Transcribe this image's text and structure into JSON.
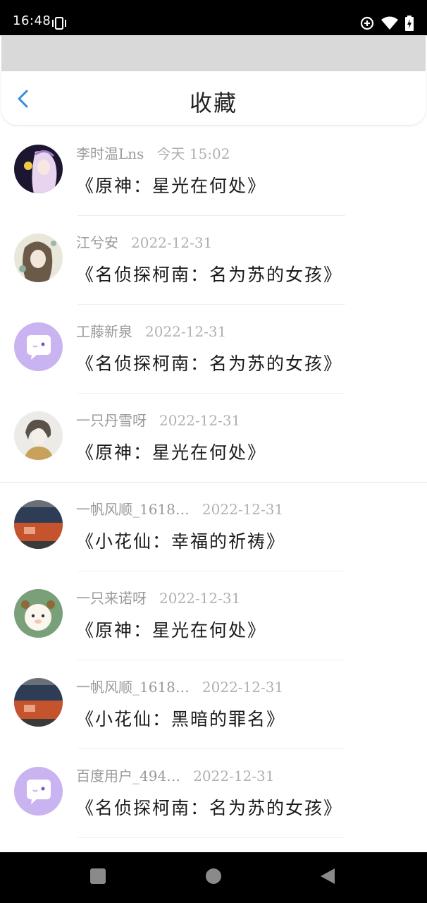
{
  "status": {
    "time": "16:48"
  },
  "header": {
    "title": "收藏"
  },
  "items": [
    {
      "user": "李时温Lns",
      "date": "今天 15:02",
      "title": "《原神：星光在何处》",
      "avatar": "anime-girl-avatar"
    },
    {
      "user": "江兮安",
      "date": "2022-12-31",
      "title": "《名侦探柯南：名为苏的女孩》",
      "avatar": "illustration-avatar"
    },
    {
      "user": "工藤新泉",
      "date": "2022-12-31",
      "title": "《名侦探柯南：名为苏的女孩》",
      "avatar": "default-chat-avatar"
    },
    {
      "user": "一只丹雪呀",
      "date": "2022-12-31",
      "title": "《原神：星光在何处》",
      "avatar": "sketch-boy-avatar"
    },
    {
      "user": "一帆风顺_1618…",
      "date": "2022-12-31",
      "title": "《小花仙：幸福的祈祷》",
      "avatar": "bus-photo-avatar"
    },
    {
      "user": "一只来诺呀",
      "date": "2022-12-31",
      "title": "《原神：星光在何处》",
      "avatar": "sheep-avatar"
    },
    {
      "user": "一帆风顺_1618…",
      "date": "2022-12-31",
      "title": "《小花仙：黑暗的罪名》",
      "avatar": "bus-photo-avatar"
    },
    {
      "user": "百度用户_494…",
      "date": "2022-12-31",
      "title": "《名侦探柯南：名为苏的女孩》",
      "avatar": "default-chat-avatar"
    }
  ],
  "colors": {
    "accent": "#2f8de4",
    "default_avatar_bg": "#c9b3f0"
  }
}
